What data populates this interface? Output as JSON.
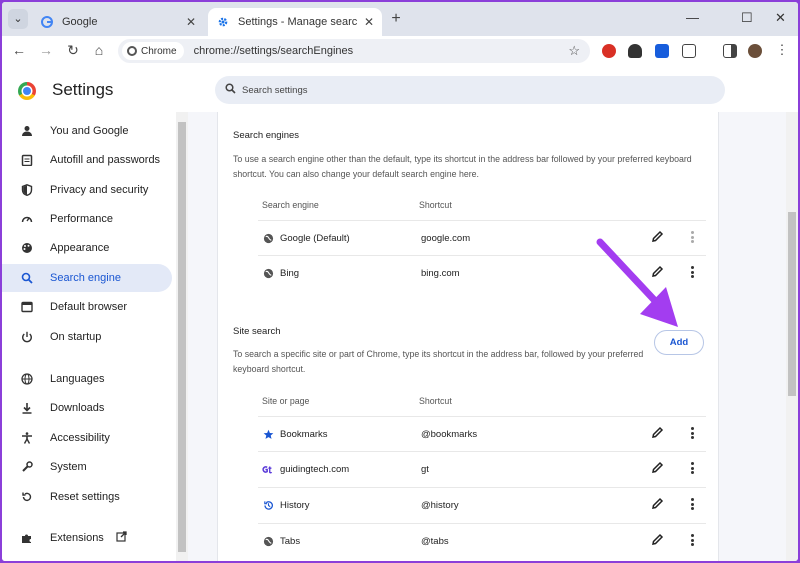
{
  "browser": {
    "tabs": [
      {
        "title": "Google",
        "favicon": "google-icon",
        "active": false
      },
      {
        "title": "Settings - Manage search engin",
        "favicon": "gear-icon",
        "active": true
      }
    ],
    "address_chip": "Chrome",
    "url": "chrome://settings/searchEngines"
  },
  "settings": {
    "title": "Settings",
    "search_placeholder": "Search settings"
  },
  "sidebar": {
    "items": [
      {
        "label": "You and Google",
        "icon": "person-icon"
      },
      {
        "label": "Autofill and passwords",
        "icon": "clipboard-icon"
      },
      {
        "label": "Privacy and security",
        "icon": "shield-icon"
      },
      {
        "label": "Performance",
        "icon": "speedometer-icon"
      },
      {
        "label": "Appearance",
        "icon": "palette-icon"
      },
      {
        "label": "Search engine",
        "icon": "search-icon",
        "selected": true
      },
      {
        "label": "Default browser",
        "icon": "browser-icon"
      },
      {
        "label": "On startup",
        "icon": "power-icon"
      },
      {
        "label": "Languages",
        "icon": "globe-icon"
      },
      {
        "label": "Downloads",
        "icon": "download-icon"
      },
      {
        "label": "Accessibility",
        "icon": "accessibility-icon"
      },
      {
        "label": "System",
        "icon": "wrench-icon"
      },
      {
        "label": "Reset settings",
        "icon": "reset-icon"
      },
      {
        "label": "Extensions",
        "icon": "puzzle-icon"
      }
    ]
  },
  "search_engines": {
    "title": "Search engines",
    "description": "To use a search engine other than the default, type its shortcut in the address bar followed by your preferred keyboard shortcut. You can also change your default search engine here.",
    "col_name": "Search engine",
    "col_shortcut": "Shortcut",
    "rows": [
      {
        "name": "Google (Default)",
        "shortcut": "google.com",
        "icon": "globe-icon"
      },
      {
        "name": "Bing",
        "shortcut": "bing.com",
        "icon": "globe-icon"
      }
    ]
  },
  "site_search": {
    "title": "Site search",
    "description": "To search a specific site or part of Chrome, type its shortcut in the address bar, followed by your preferred keyboard shortcut.",
    "add_label": "Add",
    "col_name": "Site or page",
    "col_shortcut": "Shortcut",
    "rows": [
      {
        "name": "Bookmarks",
        "shortcut": "@bookmarks",
        "icon": "star-icon"
      },
      {
        "name": "guidingtech.com",
        "shortcut": "gt",
        "icon": "gt-logo-icon"
      },
      {
        "name": "History",
        "shortcut": "@history",
        "icon": "history-icon"
      },
      {
        "name": "Tabs",
        "shortcut": "@tabs",
        "icon": "globe-icon"
      }
    ]
  },
  "colors": {
    "accent": "#1a56d2",
    "annotation_arrow": "#a33df0",
    "window_border": "#8b3fd9"
  }
}
